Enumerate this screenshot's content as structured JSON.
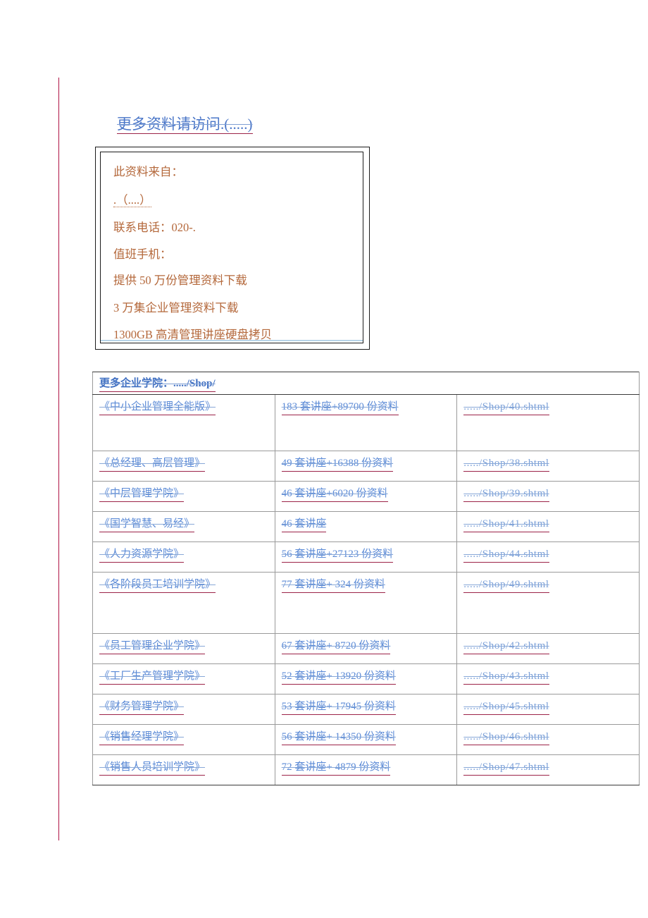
{
  "title_link": "更多资料请访问.(.....)",
  "info_box": {
    "lines": [
      "此资料来自：",
      ".（....）",
      "联系电话：020-.",
      "值班手机：",
      "提供 50 万份管理资料下载",
      "3 万集企业管理资料下载",
      "1300GB 高清管理讲座硬盘拷贝"
    ]
  },
  "table": {
    "header": "更多企业学院：...../Shop/",
    "rows": [
      {
        "name": "《中小企业管理全能版》",
        "desc": "183 套讲座+89700 份资料",
        "url": "...../Shop/40.shtml"
      },
      {
        "name": "《总经理、高层管理》",
        "desc": "49 套讲座+16388 份资料",
        "url": "...../Shop/38.shtml"
      },
      {
        "name": "《中层管理学院》",
        "desc": "46 套讲座+6020 份资料",
        "url": "...../Shop/39.shtml"
      },
      {
        "name": "《国学智慧、易经》",
        "desc": "46 套讲座",
        "url": "...../Shop/41.shtml"
      },
      {
        "name": "《人力资源学院》",
        "desc": "56 套讲座+27123 份资料",
        "url": "...../Shop/44.shtml"
      },
      {
        "name": "《各阶段员工培训学院》",
        "desc": "77 套讲座+ 324 份资料",
        "url": "...../Shop/49.shtml"
      },
      {
        "name": "《员工管理企业学院》",
        "desc": "67 套讲座+ 8720 份资料",
        "url": "...../Shop/42.shtml"
      },
      {
        "name": "《工厂生产管理学院》",
        "desc": "52 套讲座+ 13920 份资料",
        "url": "...../Shop/43.shtml"
      },
      {
        "name": "《财务管理学院》",
        "desc": "53 套讲座+ 17945 份资料",
        "url": "...../Shop/45.shtml"
      },
      {
        "name": "《销售经理学院》",
        "desc": "56 套讲座+ 14350 份资料",
        "url": "...../Shop/46.shtml"
      },
      {
        "name": "《销售人员培训学院》",
        "desc": "72 套讲座+ 4879 份资料",
        "url": "...../Shop/47.shtml"
      }
    ]
  },
  "colors": {
    "link_blue": "#5b8ad6",
    "header_blue": "#3f6fc2",
    "underline_red": "#9c2348",
    "info_text": "#b4683b",
    "margin_rule": "#b01346",
    "table_border": "#9a9a9a"
  }
}
